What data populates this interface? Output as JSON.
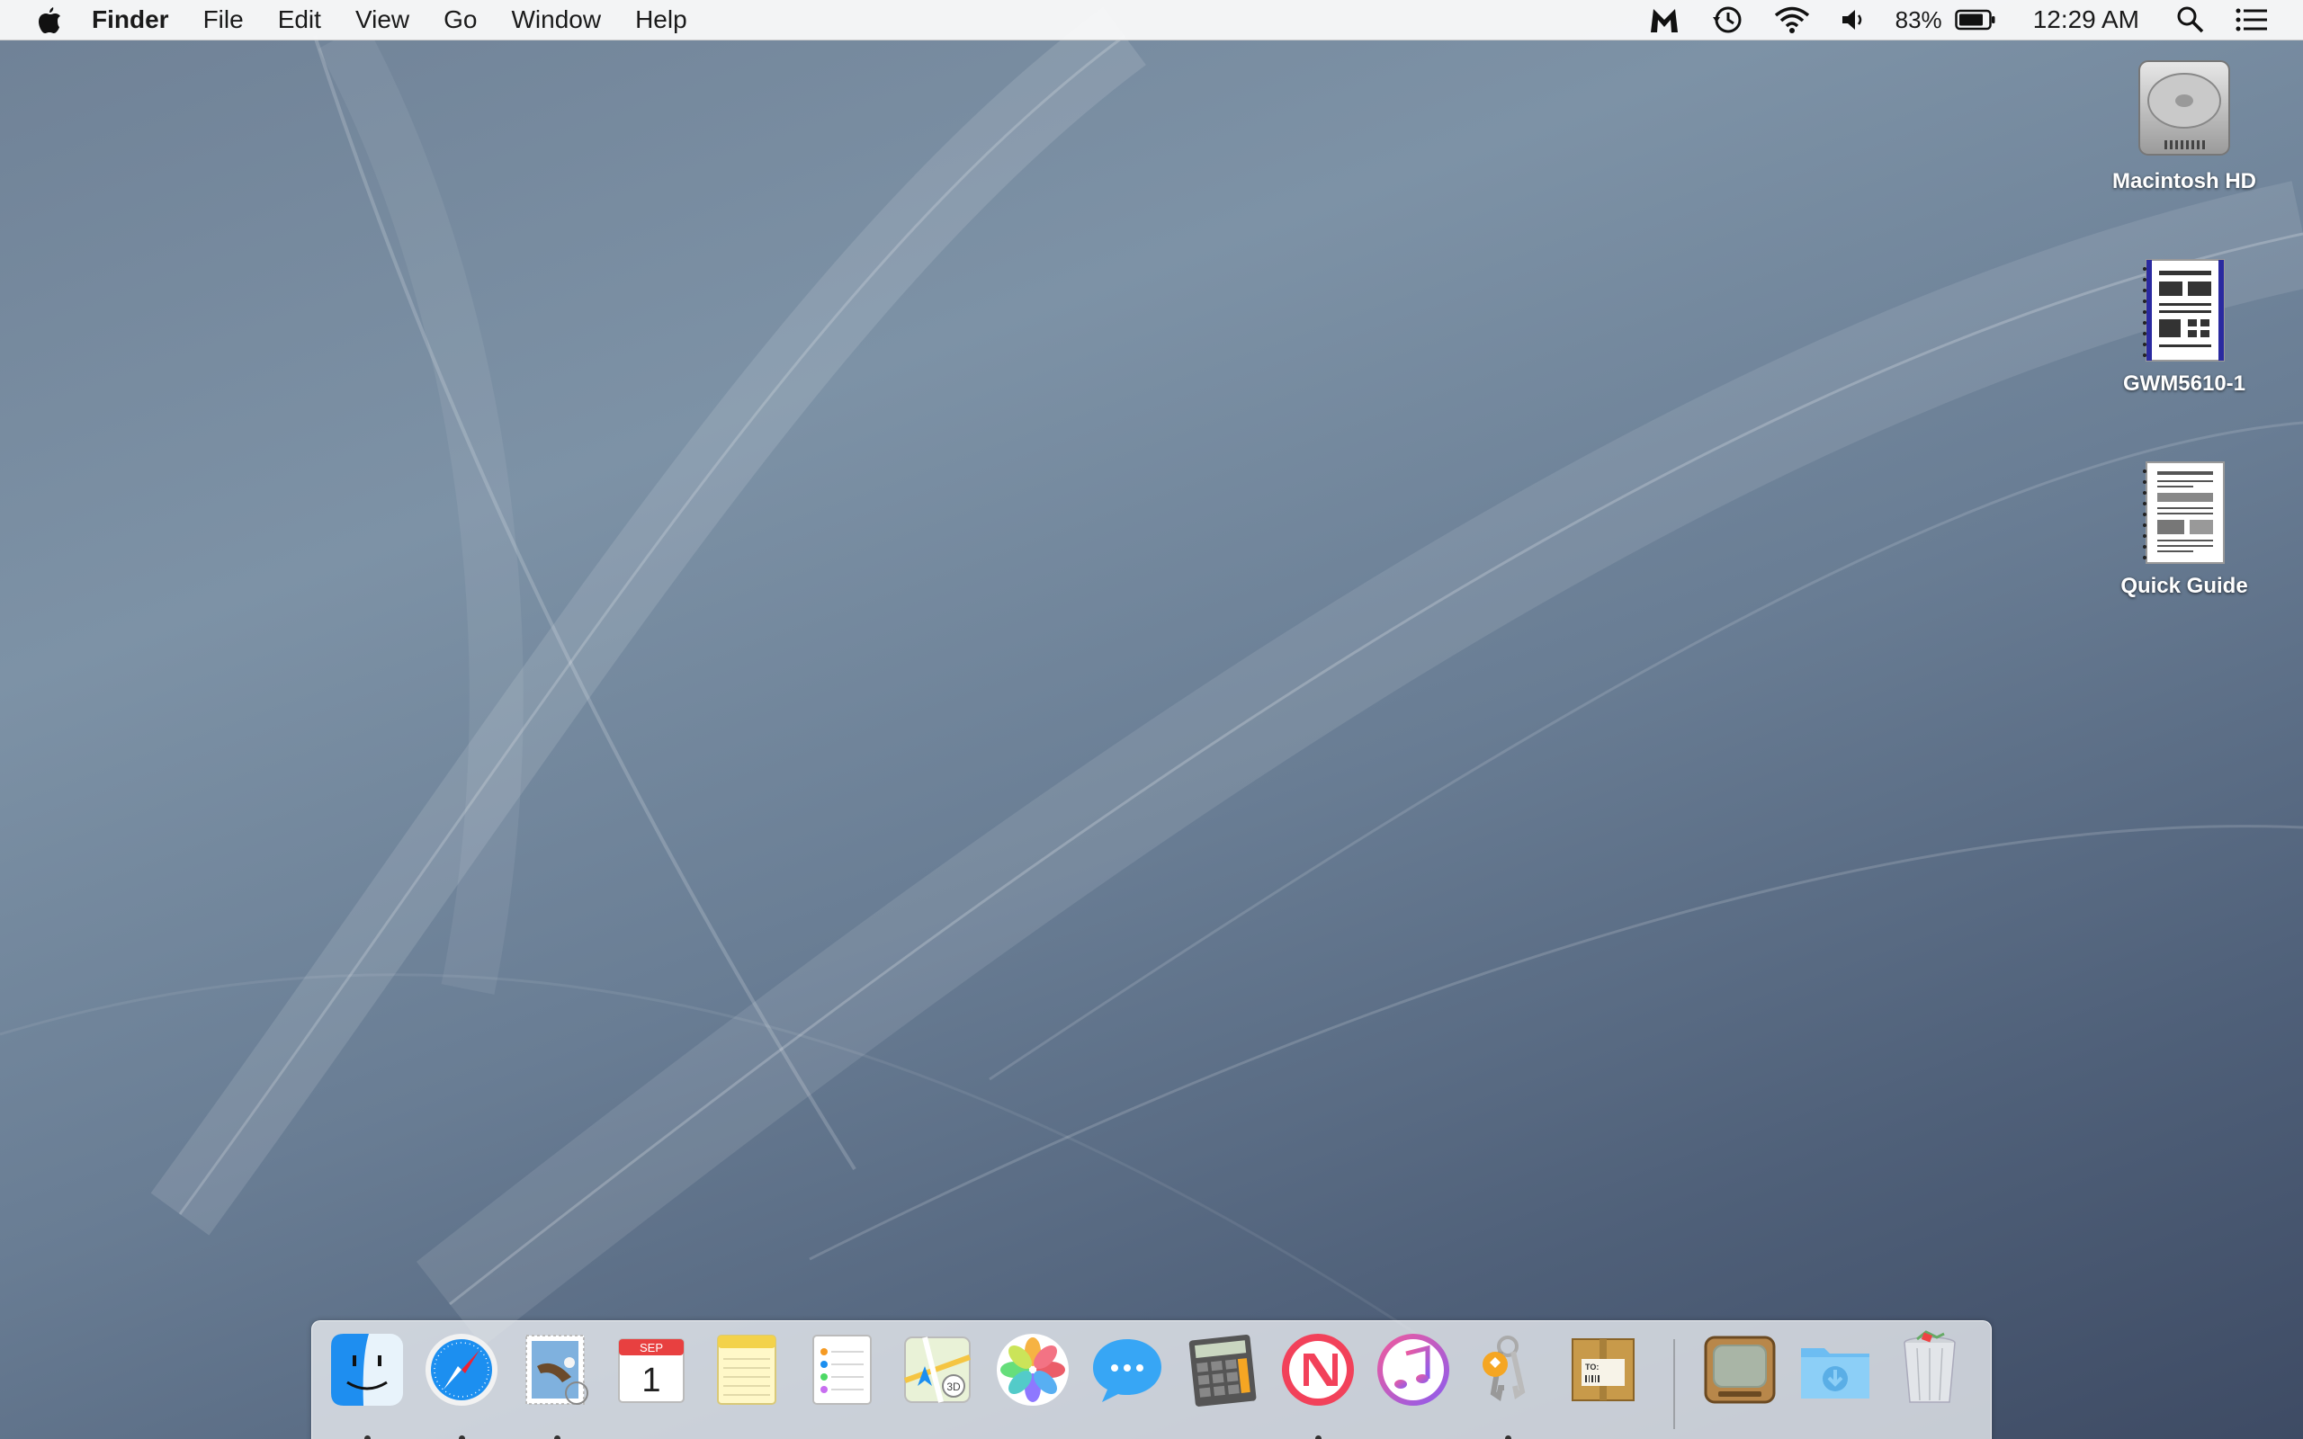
{
  "menubar": {
    "app_name": "Finder",
    "menus": [
      "File",
      "Edit",
      "View",
      "Go",
      "Window",
      "Help"
    ],
    "battery_percent": "83%",
    "clock": "12:29 AM"
  },
  "desktop": {
    "icons": [
      {
        "label": "Macintosh HD",
        "icon": "hard-drive-icon"
      },
      {
        "label": "GWM5610-1",
        "icon": "document-icon"
      },
      {
        "label": "Quick Guide",
        "icon": "document-icon"
      }
    ]
  },
  "dock": {
    "apps": [
      {
        "name": "Finder",
        "running": true
      },
      {
        "name": "Safari",
        "running": true
      },
      {
        "name": "Mail",
        "running": true
      },
      {
        "name": "Calendar",
        "running": false,
        "month": "SEP",
        "day": "1"
      },
      {
        "name": "Notes",
        "running": false
      },
      {
        "name": "Reminders",
        "running": false
      },
      {
        "name": "Maps",
        "running": false
      },
      {
        "name": "Photos",
        "running": false
      },
      {
        "name": "Messages",
        "running": false
      },
      {
        "name": "Calculator",
        "running": false
      },
      {
        "name": "News",
        "running": true
      },
      {
        "name": "iTunes",
        "running": false
      },
      {
        "name": "Keychain Access",
        "running": true
      },
      {
        "name": "Deliveries",
        "running": false,
        "label": "TO:"
      },
      {
        "name": "Retro TV",
        "running": false
      },
      {
        "name": "Downloads",
        "running": false
      },
      {
        "name": "Trash",
        "running": false
      }
    ]
  }
}
